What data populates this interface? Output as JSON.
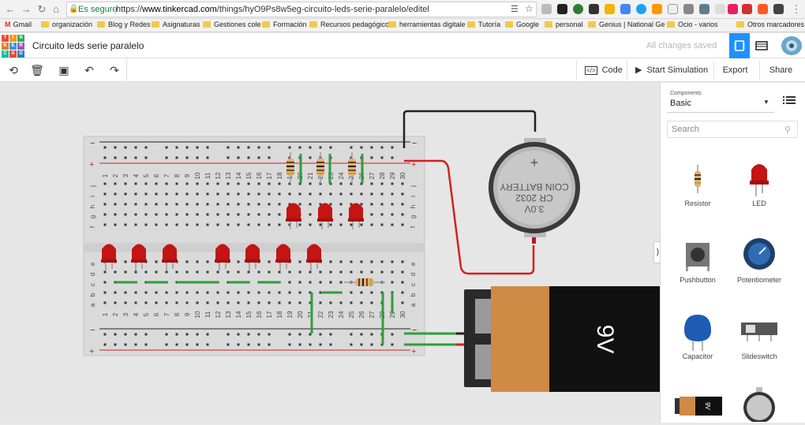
{
  "browser": {
    "security_label": "Es seguro",
    "url_scheme": "https://",
    "url_host": "www.tinkercad.com",
    "url_path": "/things/hyO9Ps8w5eg-circuito-leds-serie-paralelo/editel"
  },
  "bookmarks": [
    {
      "label": "Gmail",
      "icon": "gmail-icon"
    },
    {
      "label": "organización",
      "icon": "folder-icon"
    },
    {
      "label": "Blog y Redes",
      "icon": "folder-icon"
    },
    {
      "label": "Asignaturas",
      "icon": "folder-icon"
    },
    {
      "label": "Gestiones cole",
      "icon": "folder-icon"
    },
    {
      "label": "Formación",
      "icon": "folder-icon"
    },
    {
      "label": "Recursos pedagógico",
      "icon": "folder-icon"
    },
    {
      "label": "herramientas digitale",
      "icon": "folder-icon"
    },
    {
      "label": "Tutoría",
      "icon": "folder-icon"
    },
    {
      "label": "Google",
      "icon": "folder-icon"
    },
    {
      "label": "personal",
      "icon": "folder-icon"
    },
    {
      "label": "Genius | National Ge",
      "icon": "folder-icon"
    },
    {
      "label": "Ocio - varios",
      "icon": "folder-icon"
    },
    {
      "label": "Otros marcadores",
      "icon": "folder-icon"
    }
  ],
  "logo_letters": [
    "TIN",
    "KER",
    "CAD"
  ],
  "app": {
    "title": "Circuito leds serie paralelo",
    "save_status": "All changes saved"
  },
  "toolbar": {
    "code": "Code",
    "start_simulation": "Start Simulation",
    "export": "Export",
    "share": "Share"
  },
  "panel": {
    "components_label": "Components",
    "components_value": "Basic",
    "search_placeholder": "Search",
    "components": [
      "Resistor",
      "LED",
      "Pushbutton",
      "Potentiometer",
      "Capacitor",
      "Slideswitch"
    ]
  },
  "breadboard": {
    "column_numbers": [
      "1",
      "2",
      "3",
      "4",
      "5",
      "6",
      "7",
      "8",
      "9",
      "10",
      "11",
      "12",
      "13",
      "14",
      "15",
      "16",
      "17",
      "18",
      "19",
      "20",
      "21",
      "22",
      "23",
      "24",
      "25",
      "26",
      "27",
      "28",
      "29",
      "30"
    ],
    "row_letters_top": [
      "j",
      "i",
      "h",
      "g",
      "f"
    ],
    "row_letters_bottom": [
      "e",
      "d",
      "c",
      "b",
      "a"
    ],
    "minus": "−",
    "plus": "+"
  },
  "coin_battery": {
    "line1": "3.0V",
    "line2": "CR 2032",
    "line3": "COIN BATTERY",
    "plus": "+"
  },
  "battery_9v": {
    "label": "9V"
  },
  "colors": {
    "accent": "#1e90ff",
    "wire_red": "#d42020",
    "wire_green": "#2e9e3a",
    "led_red": "#c41414",
    "battery_orange": "#cf8a45"
  }
}
